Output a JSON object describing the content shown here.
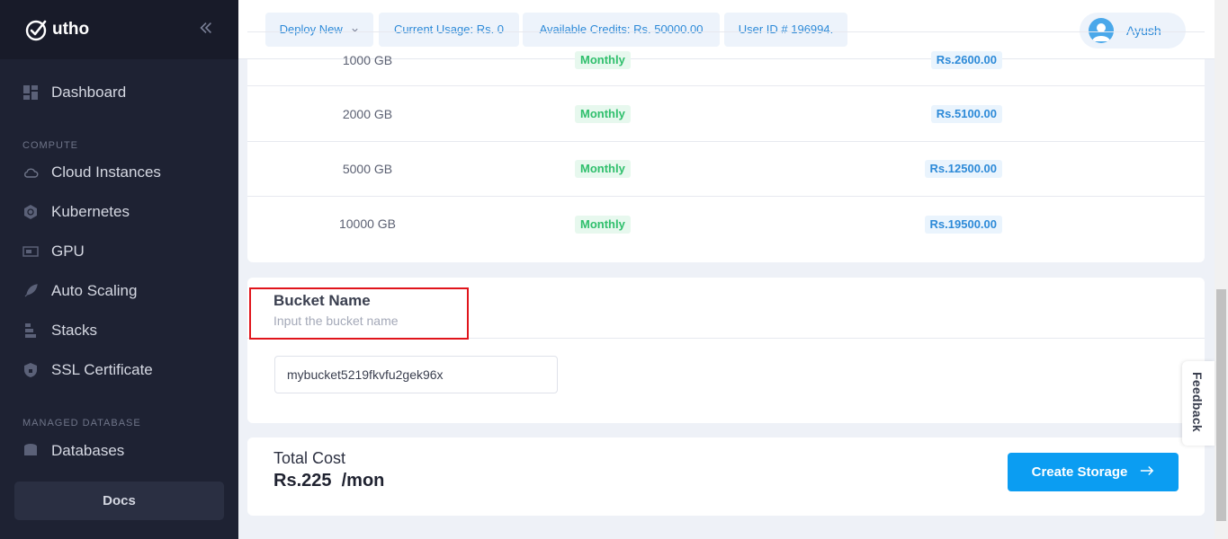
{
  "brand": {
    "name": "utho"
  },
  "sidebar": {
    "collapse_icon": "double-chevron-left-icon",
    "dashboard": "Dashboard",
    "sections": [
      {
        "label": "COMPUTE"
      },
      {
        "label": "MANAGED DATABASE"
      }
    ],
    "items": [
      {
        "label": "Cloud Instances",
        "icon": "cloud-icon"
      },
      {
        "label": "Kubernetes",
        "icon": "kubernetes-icon"
      },
      {
        "label": "GPU",
        "icon": "gpu-icon"
      },
      {
        "label": "Auto Scaling",
        "icon": "rocket-icon"
      },
      {
        "label": "Stacks",
        "icon": "stacks-icon"
      },
      {
        "label": "SSL Certificate",
        "icon": "shield-icon"
      },
      {
        "label": "Databases",
        "icon": "database-icon"
      }
    ],
    "docs": "Docs"
  },
  "topbar": {
    "deploy_new": "Deploy New",
    "current_usage": "Current Usage: Rs. 0",
    "available_credits": "Available Credits: Rs. 50000.00",
    "user_id": "User ID # 196994.",
    "user_name": "Ayush"
  },
  "pricing": {
    "rows": [
      {
        "size": "1000 GB",
        "billing": "Monthly",
        "price": "Rs.2600.00"
      },
      {
        "size": "2000 GB",
        "billing": "Monthly",
        "price": "Rs.5100.00"
      },
      {
        "size": "5000 GB",
        "billing": "Monthly",
        "price": "Rs.12500.00"
      },
      {
        "size": "10000 GB",
        "billing": "Monthly",
        "price": "Rs.19500.00"
      }
    ]
  },
  "bucket": {
    "title": "Bucket Name",
    "subtitle": "Input the bucket name",
    "value": "mybucket5219fkvfu2gek96x"
  },
  "cost": {
    "label": "Total Cost",
    "value": "Rs.225  /mon",
    "button": "Create Storage"
  },
  "feedback": "Feedback",
  "colors": {
    "accent": "#0b9df2",
    "sidebar_bg": "#1e2233",
    "highlight": "#e0141b",
    "success": "#2fbf6c"
  }
}
